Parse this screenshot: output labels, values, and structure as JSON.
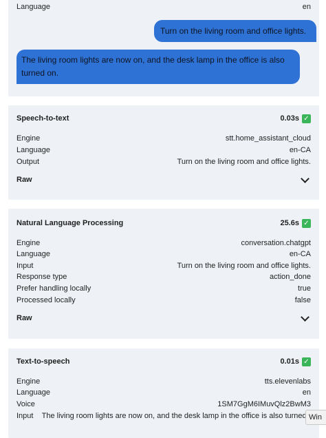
{
  "conversation": {
    "language_label": "Language",
    "language_value": "en",
    "user_message": "Turn on the living room and office lights.",
    "assistant_message": "The living room lights are now on, and the desk lamp in the office is also turned on."
  },
  "stt": {
    "title": "Speech-to-text",
    "duration": "0.03s",
    "rows": [
      {
        "key": "Engine",
        "value": "stt.home_assistant_cloud"
      },
      {
        "key": "Language",
        "value": "en-CA"
      },
      {
        "key": "Output",
        "value": "Turn on the living room and office lights."
      }
    ],
    "raw_label": "Raw"
  },
  "nlp": {
    "title": "Natural Language Processing",
    "duration": "25.6s",
    "rows": [
      {
        "key": "Engine",
        "value": "conversation.chatgpt"
      },
      {
        "key": "Language",
        "value": "en-CA"
      },
      {
        "key": "Input",
        "value": "Turn on the living room and office lights."
      },
      {
        "key": "Response type",
        "value": "action_done"
      },
      {
        "key": "Prefer handling locally",
        "value": "true"
      },
      {
        "key": "Processed locally",
        "value": "false"
      }
    ],
    "raw_label": "Raw"
  },
  "tts": {
    "title": "Text-to-speech",
    "duration": "0.01s",
    "rows": [
      {
        "key": "Engine",
        "value": "tts.elevenlabs"
      },
      {
        "key": "Language",
        "value": "en"
      },
      {
        "key": "Voice",
        "value": "1SM7GgM6IMuvQlz2BwM3"
      },
      {
        "key": "Input",
        "value": "The living room lights are now on, and the desk lamp in the office is also turned on."
      }
    ]
  },
  "overlay": {
    "label": "Win"
  },
  "colors": {
    "card_bg": "#eef2f6",
    "bubble_bg": "#2f72d6",
    "check_bg": "#3bb55a"
  }
}
